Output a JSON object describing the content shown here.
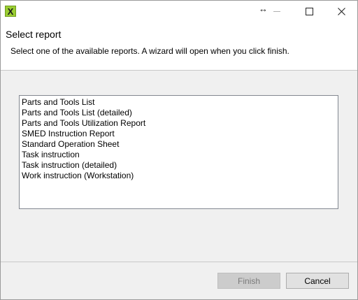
{
  "titlebar": {
    "app_icon_glyph": "X",
    "app_icon_color": "#9acd32",
    "resize_glyph": "↔",
    "controls": [
      "minimize-icon",
      "maximize-icon",
      "close-icon"
    ]
  },
  "header": {
    "title": "Select report",
    "description": "Select one of the available reports. A wizard will open when you click finish."
  },
  "reports": [
    "Parts and Tools List",
    "Parts and Tools List (detailed)",
    "Parts and Tools Utilization Report",
    "SMED Instruction Report",
    "Standard Operation Sheet",
    "Task instruction",
    "Task instruction (detailed)",
    "Work instruction (Workstation)"
  ],
  "buttons": {
    "finish": "Finish",
    "finish_enabled": false,
    "cancel": "Cancel"
  }
}
